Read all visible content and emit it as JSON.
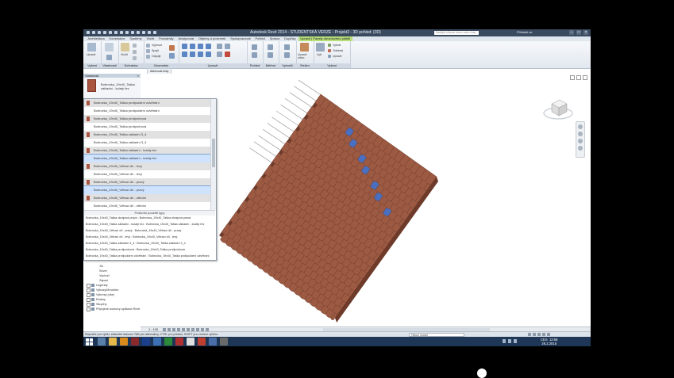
{
  "titlebar": {
    "title": "Autodesk Revit 2014 - STUDENTSKÁ VERZE  -  Projekt2 - 3D pohled: {3D}",
    "search_placeholder": "Zadejte klíčové slovo nebo frázi",
    "user": "Přihlásit se"
  },
  "ribbon_tabs": [
    {
      "label": "Architektura",
      "state": "normal"
    },
    {
      "label": "Konstrukce",
      "state": "normal"
    },
    {
      "label": "Systémy",
      "state": "normal"
    },
    {
      "label": "Vložit",
      "state": "normal"
    },
    {
      "label": "Poznámky",
      "state": "normal"
    },
    {
      "label": "Analyzovat",
      "state": "normal"
    },
    {
      "label": "Objemy a pozemek",
      "state": "normal"
    },
    {
      "label": "Spolupracovat",
      "state": "normal"
    },
    {
      "label": "Pohled",
      "state": "normal"
    },
    {
      "label": "Správa",
      "state": "normal"
    },
    {
      "label": "Doplňky",
      "state": "normal"
    },
    {
      "label": "Upravit | Panely obvodového pláště",
      "state": "context"
    }
  ],
  "ribbon_groups": [
    {
      "label": "Vybrat",
      "key": "vybrat"
    },
    {
      "label": "Vlastnosti",
      "key": "vlastnosti"
    },
    {
      "label": "Schránka",
      "key": "schranka"
    },
    {
      "label": "Geometrie",
      "key": "geometrie"
    },
    {
      "label": "Upravit",
      "key": "upravit"
    },
    {
      "label": "Pohled",
      "key": "pohled"
    },
    {
      "label": "Měření",
      "key": "mereni"
    },
    {
      "label": "Vytvořit",
      "key": "vytvorit"
    },
    {
      "label": "Režim",
      "key": "rezim"
    },
    {
      "label": "Vybrat",
      "key": "vybrat2"
    }
  ],
  "ribbon_buttons": {
    "modify": "Upravit",
    "paste": "Vložit",
    "cut": "Vyjmout",
    "join": "Spojit",
    "unjoin": "Odpojit",
    "upravit_zdivo": "Upravit zdivo",
    "vybrat_btn": "Vyb.",
    "odebrat": "Odebrat",
    "upravit_small": "Upravit"
  },
  "context_bar": "Aktivovat kóty",
  "properties": {
    "header": "Vlastnosti",
    "type_name": "Bobrovka_19x40_Taška základní - kulatý řez"
  },
  "type_list": [
    {
      "label": "Bobrovka_19x40_Taška protipožární odvětrání",
      "style": "alt"
    },
    {
      "label": "Bobrovka_19x40_Taška protipožární odvětrání",
      "style": "normal"
    },
    {
      "label": "Bobrovka_19x40_Taška protiprohová",
      "style": "alt"
    },
    {
      "label": "Bobrovka_19x40_Taška protiprohová",
      "style": "normal"
    },
    {
      "label": "Bobrovka_19x40_Taška základní 3_4",
      "style": "alt"
    },
    {
      "label": "Bobrovka_19x40_Taška základní 3_4",
      "style": "normal"
    },
    {
      "label": "Bobrovka_19x40_Taška základní - kulatý řez",
      "style": "alt"
    },
    {
      "label": "Bobrovka_19x40_Taška základní - kulatý řez",
      "style": "sel"
    },
    {
      "label": "Bobrovka_19x40_Větrací díl - levý",
      "style": "alt"
    },
    {
      "label": "Bobrovka_19x40_Větrací díl - levý",
      "style": "normal"
    },
    {
      "label": "Bobrovka_19x40_Větrací díl - pravý",
      "style": "alt"
    },
    {
      "label": "Bobrovka_19x40_Větrací díl - pravý",
      "style": "sel"
    },
    {
      "label": "Bobrovka_19x40_Větrací díl - střední",
      "style": "alt"
    },
    {
      "label": "Bobrovka_19x40_Větrací díl - střední",
      "style": "normal"
    }
  ],
  "recent_header": "Poslední použité typy",
  "recent_list": [
    "Bobrovka_19x40_Taška okrajová pravá : Bobrovka_19x40_Taška okrajová pravá",
    "Bobrovka_19x40_Taška základní - kulatý řez : Bobrovka_19x40_Taška základní - kulatý řez",
    "Bobrovka_19x40_Větrací díl - pravý : Bobrovka_19x40_Větrací díl - pravý",
    "Bobrovka_19x40_Větrací díl - levý : Bobrovka_19x40_Větrací díl - levý",
    "Bobrovka_19x40_Taška základní 3_4 : Bobrovka_19x40_Taška základní 3_4",
    "Bobrovka_19x40_Taška protiprohová : Bobrovka_19x40_Taška protiprohová",
    "Bobrovka_19x40_Taška protipožární odvětrání : Bobrovka_19x40_Taška protipožární odvětrání"
  ],
  "browser": [
    {
      "label": "Jih",
      "indent": 1,
      "kind": "leaf"
    },
    {
      "label": "Sever",
      "indent": 1,
      "kind": "leaf"
    },
    {
      "label": "Východ",
      "indent": 1,
      "kind": "leaf"
    },
    {
      "label": "Západ",
      "indent": 1,
      "kind": "leaf"
    },
    {
      "label": "Legendy",
      "indent": 0,
      "kind": "node"
    },
    {
      "label": "Výkazy/Množství",
      "indent": 0,
      "kind": "node"
    },
    {
      "label": "Výkresy (vše)",
      "indent": 0,
      "kind": "node"
    },
    {
      "label": "Rodiny",
      "indent": 0,
      "kind": "node"
    },
    {
      "label": "Skupiny",
      "indent": 0,
      "kind": "node"
    },
    {
      "label": "Připojené soubory aplikace Revit",
      "indent": 0,
      "kind": "node"
    }
  ],
  "view_control": {
    "scale": "1 : 100"
  },
  "status": {
    "message": "Klepněte pro výběr, stiskněte klávesu TAB pro alternativy, CTRL pro přidání, SHIFT pro zrušení výběru.",
    "model": "Hlavní model"
  },
  "taskbar": {
    "lang": "CES",
    "time": "13:58",
    "date": "26.2.2015",
    "apps": [
      "#5a7fa8",
      "#e8b84a",
      "#d88a1c",
      "#8a2a2a",
      "#1b3f8a",
      "#3c6fb4",
      "#2a8a3a",
      "#b03030",
      "#e0e0e0",
      "#c04030",
      "#4a6ea8",
      "#6a6a6a"
    ]
  },
  "colors": {
    "tile": "#9c5a43",
    "tile_dark": "#6e3a2a",
    "tile_selected": "#4a6fc0",
    "ribbon_context": "#b8df7a"
  }
}
